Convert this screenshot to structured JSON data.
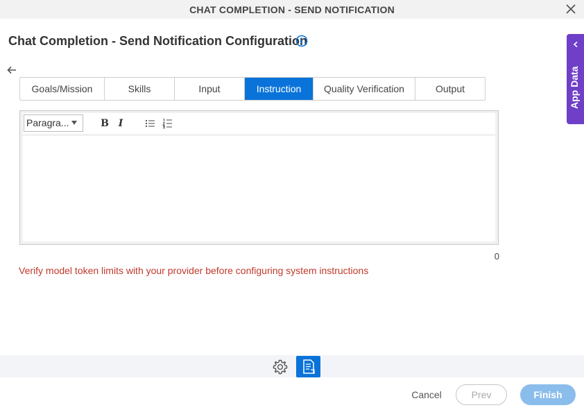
{
  "window": {
    "title": "CHAT COMPLETION - SEND NOTIFICATION",
    "close_icon": "close-icon"
  },
  "header": {
    "title": "Chat Completion - Send Notification Configuration",
    "info_icon": "info-icon",
    "back_icon": "arrow-left-icon"
  },
  "tabs": [
    {
      "label": "Goals/Mission",
      "active": false
    },
    {
      "label": "Skills",
      "active": false
    },
    {
      "label": "Input",
      "active": false
    },
    {
      "label": "Instruction",
      "active": true
    },
    {
      "label": "Quality Verification",
      "active": false
    },
    {
      "label": "Output",
      "active": false
    }
  ],
  "editor": {
    "format_select": "Paragra...",
    "bold_label": "B",
    "italic_label": "I",
    "bullet_list_icon": "bullet-list-icon",
    "numbered_list_icon": "numbered-list-icon",
    "content": "",
    "char_count": "0"
  },
  "warning": "Verify model token limits with your provider before configuring system instructions",
  "app_data": {
    "label": "App Data",
    "chevron_icon": "chevron-left-icon"
  },
  "bottom_toolbar": {
    "settings_icon": "gear-icon",
    "document_icon": "document-icon"
  },
  "footer": {
    "cancel_label": "Cancel",
    "prev_label": "Prev",
    "finish_label": "Finish"
  },
  "colors": {
    "accent": "#0a73d9",
    "app_data_tab": "#6f3fc8",
    "warning": "#c0392b",
    "finish_button": "#8bbdec"
  }
}
